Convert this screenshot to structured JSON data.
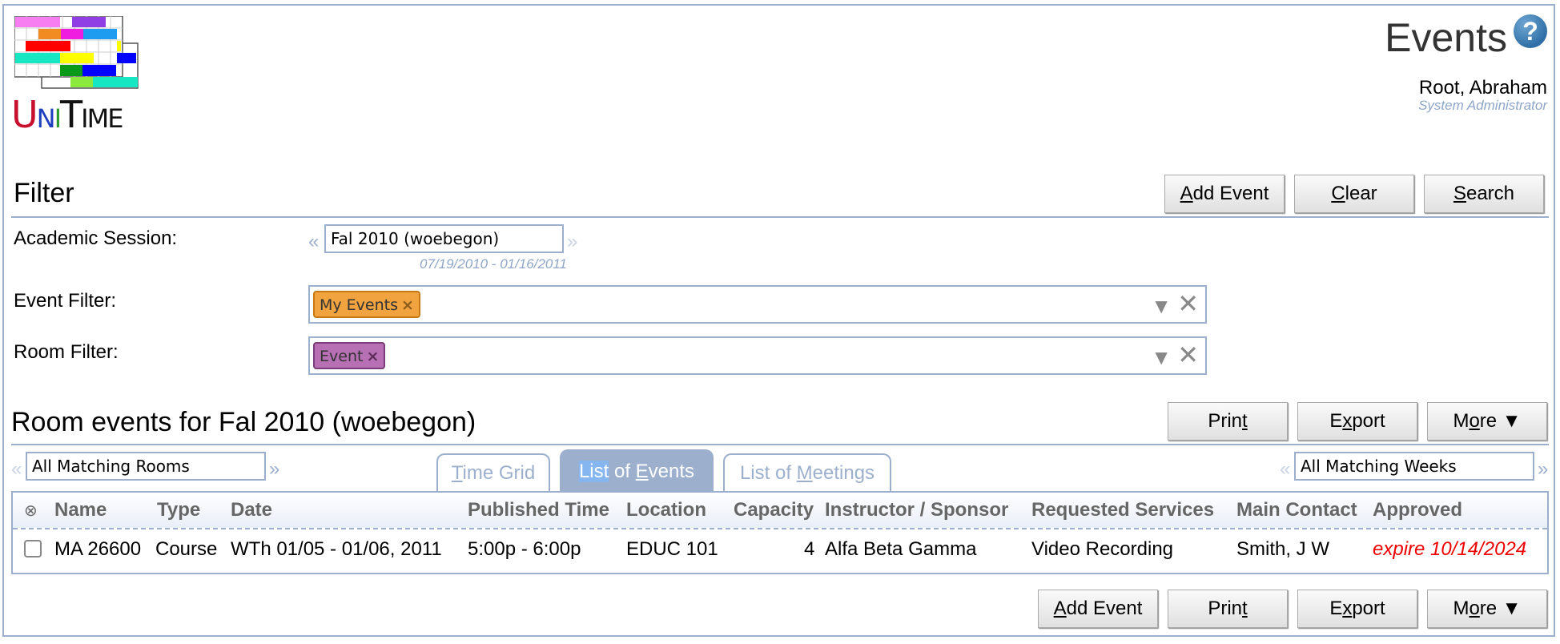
{
  "header": {
    "logo": {
      "u": "U",
      "n": "N",
      "i": "I",
      "t": "T",
      "ime": "IME"
    },
    "title": "Events",
    "help_icon": "?",
    "user_name": "Root, Abraham",
    "user_role": "System Administrator"
  },
  "filter": {
    "title": "Filter",
    "buttons": {
      "add_event": "dd Event",
      "add_event_key": "A",
      "clear": "lear",
      "clear_key": "C",
      "search": "earch",
      "search_key": "S"
    },
    "academic_session": {
      "label": "Academic Session:",
      "value": "Fal 2010 (woebegon)",
      "date_range": "07/19/2010 - 01/16/2011",
      "prev": "«",
      "next": "»"
    },
    "event_filter": {
      "label": "Event Filter:",
      "chip": "My Events",
      "chip_remove": "×"
    },
    "room_filter": {
      "label": "Room Filter:",
      "chip": "Event",
      "chip_remove": "×"
    },
    "dropdown_icon": "▼",
    "clear_icon": "✕"
  },
  "results": {
    "title": "Room events for Fal 2010 (woebegon)",
    "buttons": {
      "print_pre": "Prin",
      "print_key": "t",
      "export_pre": "E",
      "export_key": "x",
      "export_post": "port",
      "more_pre": "M",
      "more_key": "o",
      "more_post": "re ▼",
      "add_event_key": "A",
      "add_event": "dd Event"
    },
    "rooms_selector": {
      "value": "All Matching Rooms",
      "prev": "«",
      "next": "»"
    },
    "weeks_selector": {
      "value": "All Matching Weeks",
      "prev": "«",
      "next": "»"
    },
    "tabs": [
      {
        "key": "T",
        "rest": "ime Grid",
        "active": false
      },
      {
        "sel": "List",
        "pre": " of ",
        "key": "E",
        "rest": "vents",
        "active": true
      },
      {
        "pre": "List of ",
        "key": "M",
        "rest": "eetings",
        "active": false
      }
    ],
    "table": {
      "select_all_icon": "⊗",
      "columns": [
        "Name",
        "Type",
        "Date",
        "Published Time",
        "Location",
        "Capacity",
        "Instructor / Sponsor",
        "Requested Services",
        "Main Contact",
        "Approved"
      ],
      "rows": [
        {
          "name": "MA 26600",
          "type": "Course",
          "date": "WTh 01/05 - 01/06, 2011",
          "time": "5:00p - 6:00p",
          "location": "EDUC 101",
          "capacity": "4",
          "sponsor": "Alfa Beta Gamma",
          "services": "Video Recording",
          "contact": "Smith, J W",
          "approved": "expire 10/14/2024"
        }
      ]
    }
  },
  "colors": {
    "border": "#9cb0ce",
    "expire": "#ee0000",
    "event_chip": "#f0a33e",
    "room_chip": "#b670b3"
  }
}
